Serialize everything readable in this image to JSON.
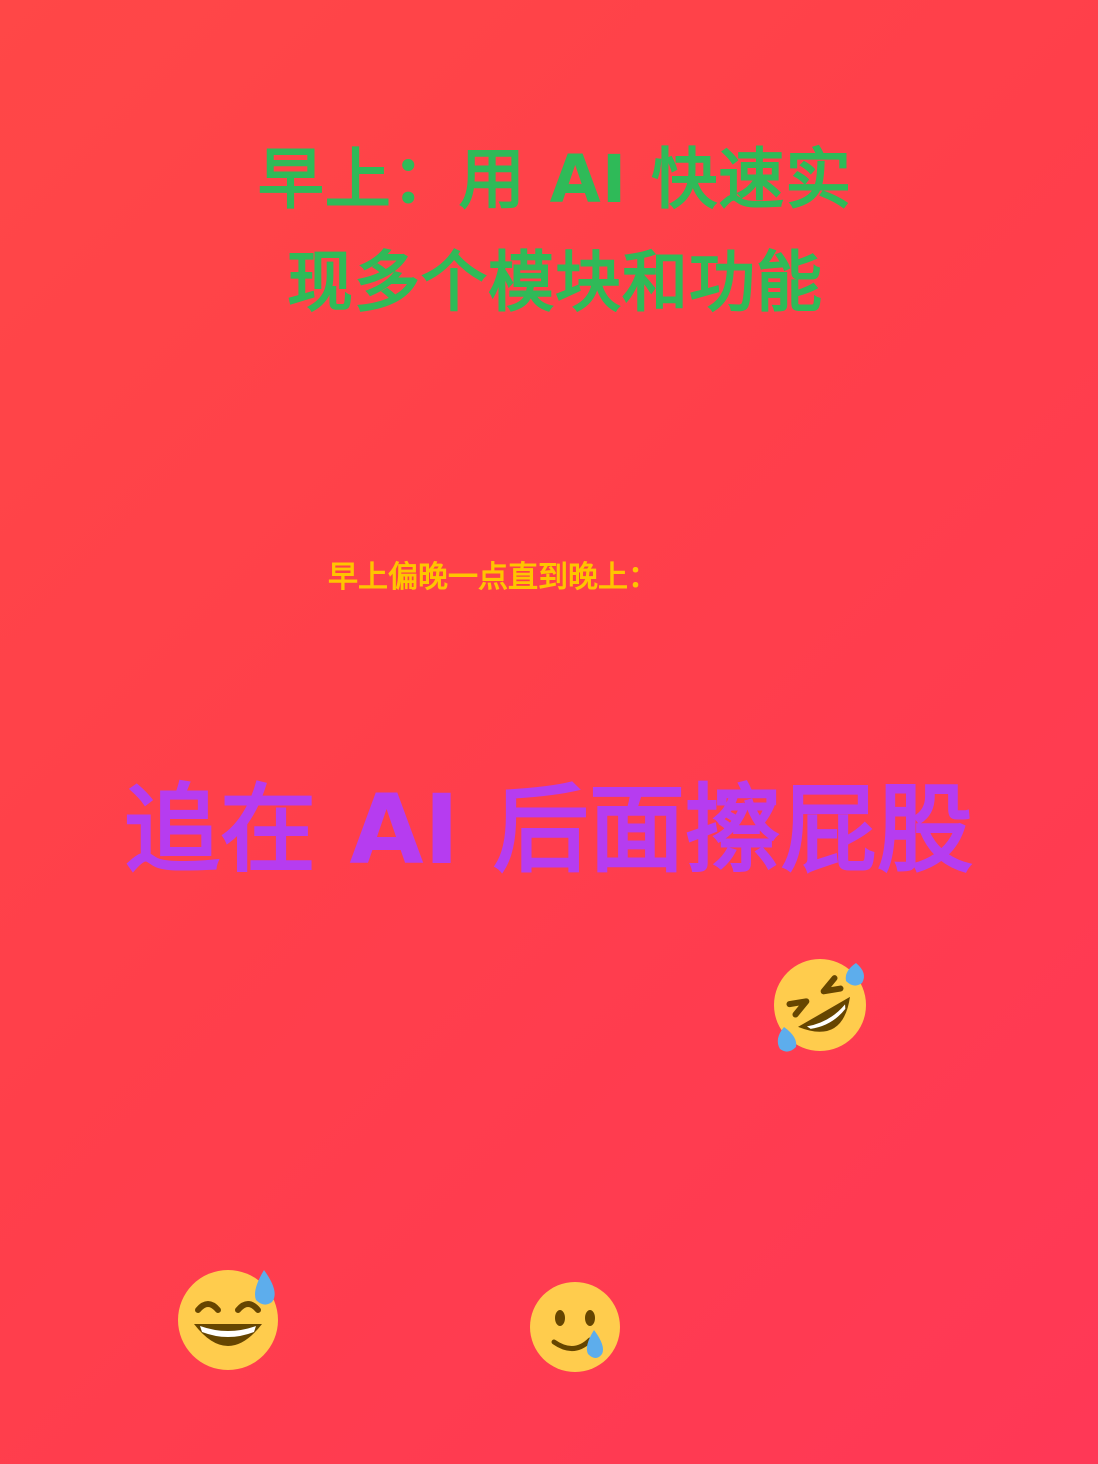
{
  "headline": "早上：用 AI 快速实现多个模块和功能",
  "subline": "早上偏晚一点直到晚上：",
  "punchline": "追在 AI 后面擦屁股",
  "emojis": [
    {
      "icon": "rolling-on-floor-laughing-emoji"
    },
    {
      "icon": "grinning-sweat-emoji"
    },
    {
      "icon": "smiling-face-with-tear-emoji"
    }
  ],
  "colors": {
    "background": "#ff4149",
    "headline": "#2fba58",
    "subline": "#ffc400",
    "punchline": "#b63cf0"
  }
}
